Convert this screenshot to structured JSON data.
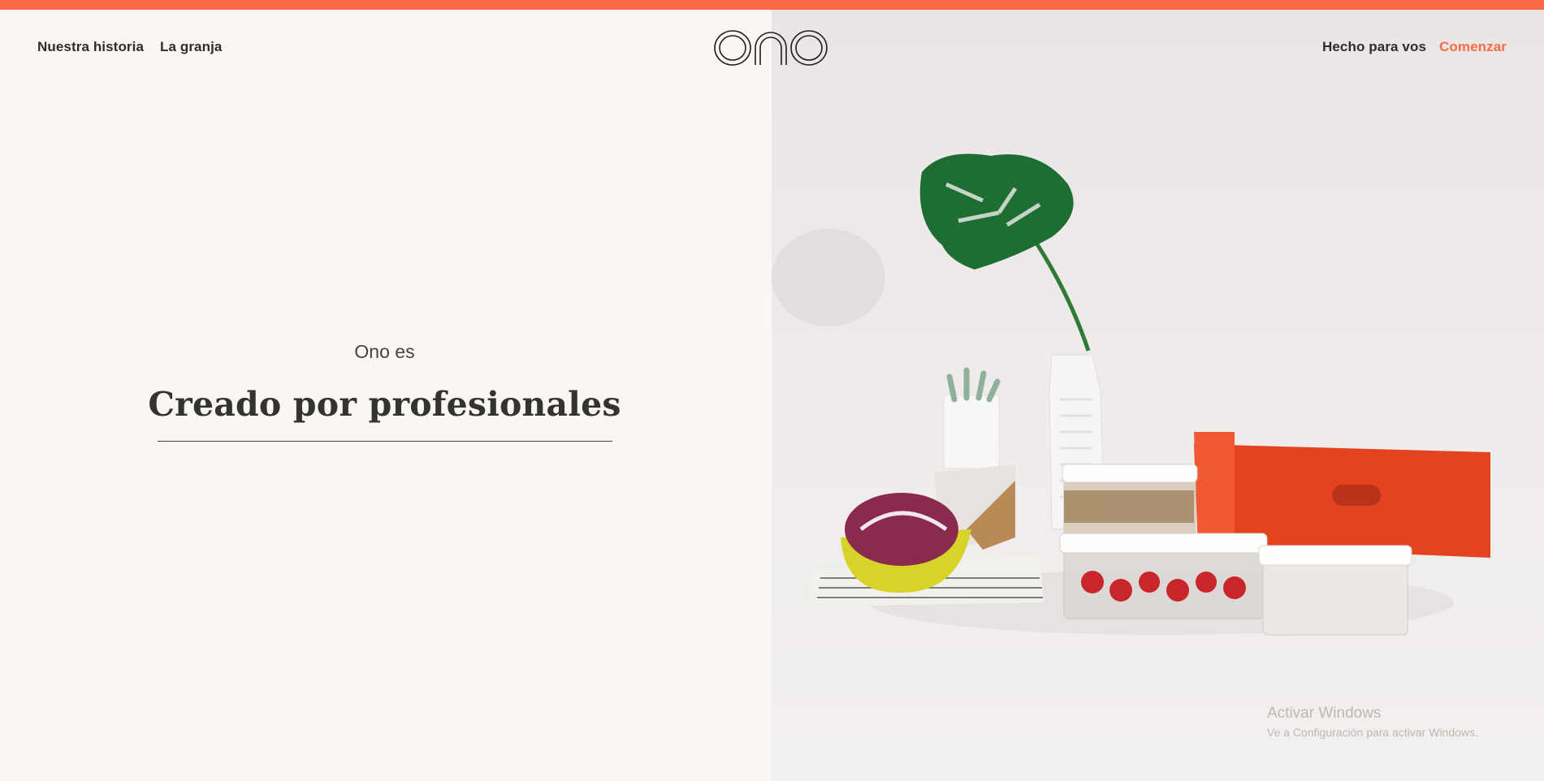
{
  "nav": {
    "left": [
      "Nuestra historia",
      "La granja"
    ],
    "right": [
      "Hecho para vos",
      "Comenzar"
    ],
    "logo_text": "ono"
  },
  "hero": {
    "subtitle": "Ono es",
    "title": "Creado por profesionales"
  },
  "watermark": {
    "line1": "Activar Windows",
    "line2": "Ve a Configuración para activar Windows."
  },
  "colors": {
    "accent": "#fd6a45",
    "background": "#faf7f3",
    "text": "#2e2b2b"
  }
}
